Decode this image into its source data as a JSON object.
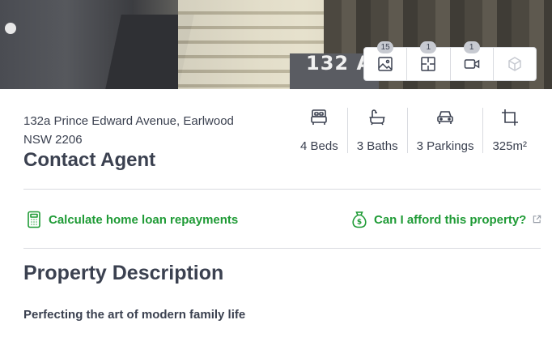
{
  "hero": {
    "sign_text": "132 A",
    "media": [
      {
        "name": "photos",
        "count": "15"
      },
      {
        "name": "floorplan",
        "count": "1"
      },
      {
        "name": "video",
        "count": "1"
      },
      {
        "name": "3d-tour",
        "count": ""
      }
    ]
  },
  "listing": {
    "address_line1": "132a Prince Edward Avenue, Earlwood",
    "address_line2": "NSW 2206",
    "price": "Contact Agent",
    "features": {
      "beds": "4 Beds",
      "baths": "3 Baths",
      "parkings": "3 Parkings",
      "land": "325m²"
    }
  },
  "links": {
    "loan": "Calculate home loan repayments",
    "afford": "Can I afford this property?"
  },
  "description": {
    "title": "Property Description",
    "heading": "Perfecting the art of modern family life"
  },
  "colors": {
    "accent": "#1f9b36",
    "text": "#3b4150",
    "divider": "#d9dbe0"
  }
}
